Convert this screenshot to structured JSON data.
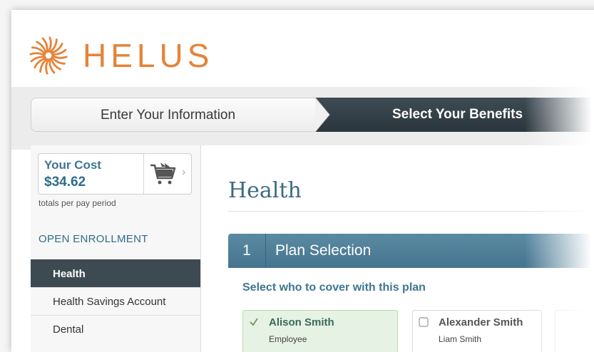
{
  "brand": {
    "name": "HELUS",
    "logo_icon": "sun-burst-logo-icon",
    "color": "#e5843a"
  },
  "steps": [
    {
      "label": "Enter Your Information",
      "state": "complete"
    },
    {
      "label": "Select Your Benefits",
      "state": "active"
    }
  ],
  "sidebar": {
    "cost": {
      "label": "Your Cost",
      "value": "$34.62",
      "icon": "cart-icon",
      "note": "totals per pay period"
    },
    "section_title": "OPEN ENROLLMENT",
    "items": [
      {
        "label": "Health",
        "active": true
      },
      {
        "label": "Health Savings Account",
        "active": false
      },
      {
        "label": "Dental",
        "active": false
      }
    ]
  },
  "main": {
    "title": "Health",
    "plan_section": {
      "number": "1",
      "title": "Plan Selection"
    },
    "cover_question": "Select who to cover with this plan",
    "members": [
      {
        "name": "Alison Smith",
        "role": "Employee",
        "selected": true
      },
      {
        "name": "Alexander Smith",
        "role": "Liam Smith",
        "selected": false
      }
    ]
  },
  "colors": {
    "accent_blue": "#2f6c8a",
    "nav_active": "#3d4a52",
    "selected_card": "#e6f2e3"
  }
}
